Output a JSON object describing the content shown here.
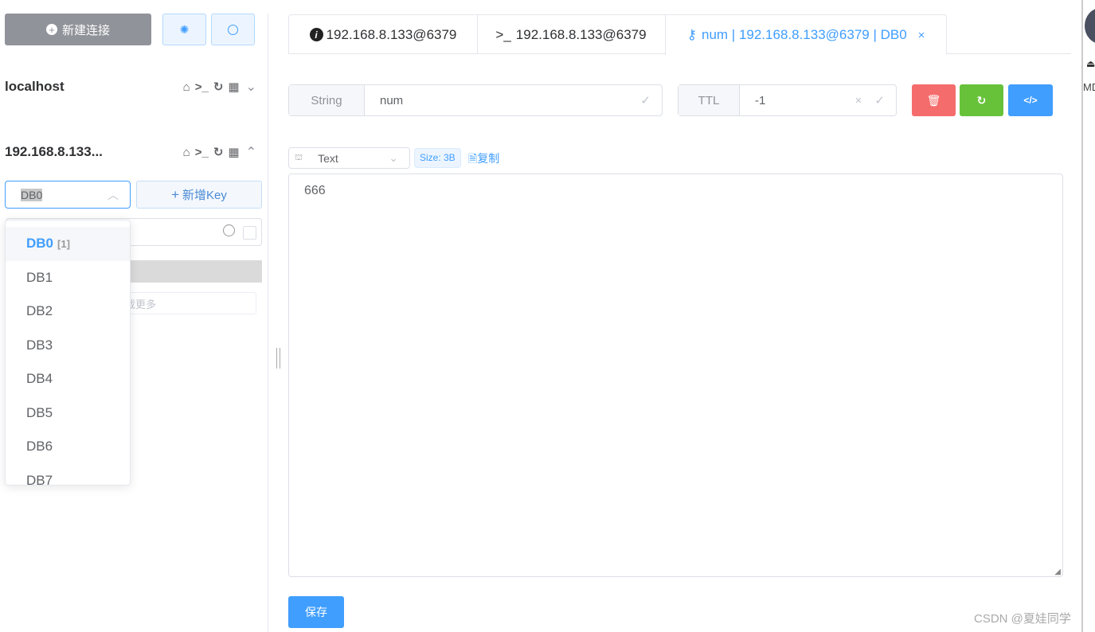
{
  "sidebar": {
    "new_connection": "新建连接",
    "connections": [
      {
        "name": "localhost",
        "expanded": false
      },
      {
        "name": "192.168.8.133...",
        "expanded": true
      }
    ],
    "db_select": {
      "value": "DB0",
      "options": [
        {
          "label": "DB0",
          "count": "[1]"
        },
        {
          "label": "DB1"
        },
        {
          "label": "DB2"
        },
        {
          "label": "DB3"
        },
        {
          "label": "DB4"
        },
        {
          "label": "DB5"
        },
        {
          "label": "DB6"
        },
        {
          "label": "DB7"
        }
      ]
    },
    "new_key": "新增Key",
    "load_more": "加载更多"
  },
  "tabs": [
    {
      "label": "192.168.8.133@6379",
      "icon": "info-icon"
    },
    {
      "label": "192.168.8.133@6379",
      "icon": "terminal-icon"
    },
    {
      "label": "num | 192.168.8.133@6379 | DB0",
      "icon": "key-icon",
      "active": true
    }
  ],
  "key": {
    "type": "String",
    "name": "num",
    "ttl_label": "TTL",
    "ttl": "-1"
  },
  "viewer": {
    "format": "Text",
    "size": "Size: 3B",
    "copy": "复制",
    "value": "666"
  },
  "save": "保存",
  "watermark": "CSDN @夏娃同学",
  "side_text": "MD",
  "colors": {
    "accent": "#409eff",
    "danger": "#f56c6c",
    "success": "#67c23a"
  }
}
